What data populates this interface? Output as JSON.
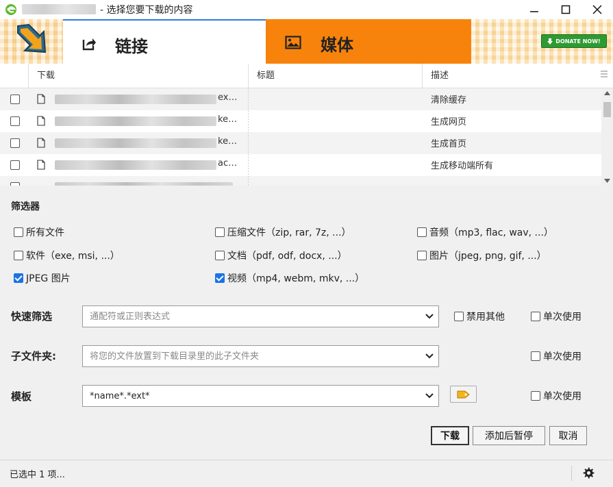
{
  "window": {
    "title": "- 选择您要下载的内容",
    "controls": [
      "minimize-icon",
      "maximize-icon",
      "close-icon"
    ]
  },
  "tabs": [
    {
      "label": "链接",
      "icon": "share-arrow-icon",
      "active": true
    },
    {
      "label": "媒体",
      "icon": "image-icon",
      "active": false
    }
  ],
  "donate_label": "DONATE NOW!",
  "colors": {
    "media_tab": "#f7830c",
    "active_tab_border": "#2b7de0",
    "donate": "#2f9a32",
    "checkbox_checked": "#1a73e8"
  },
  "table": {
    "columns": [
      "下载",
      "标题",
      "描述"
    ],
    "rows": [
      {
        "suffix": "ex…",
        "title": "",
        "desc": "清除缓存",
        "checked": false
      },
      {
        "suffix": "ke…",
        "title": "",
        "desc": "生成网页",
        "checked": false
      },
      {
        "suffix": "ke…",
        "title": "",
        "desc": "生成首页",
        "checked": false
      },
      {
        "suffix": "ac…",
        "title": "",
        "desc": "生成移动端所有",
        "checked": false
      }
    ]
  },
  "filters": {
    "title": "筛选器",
    "items": [
      {
        "label": "所有文件",
        "checked": false
      },
      {
        "label": "压缩文件（zip, rar, 7z, ...）",
        "checked": false
      },
      {
        "label": "音频（mp3, flac, wav, ...）",
        "checked": false
      },
      {
        "label": "软件（exe, msi, ...）",
        "checked": false
      },
      {
        "label": "文档（pdf, odf, docx, ...）",
        "checked": false
      },
      {
        "label": "图片（jpeg, png, gif, ...）",
        "checked": false
      },
      {
        "label": "JPEG 图片",
        "checked": true
      },
      {
        "label": "视频（mp4, webm, mkv, ...）",
        "checked": true
      }
    ]
  },
  "quick_filter": {
    "label": "快速筛选",
    "placeholder": "通配符或正则表达式",
    "disable_others": "禁用其他",
    "once": "单次使用"
  },
  "subfolder": {
    "label": "子文件夹:",
    "placeholder": "将您的文件放置到下载目录里的此子文件夹",
    "once": "单次使用"
  },
  "template": {
    "label": "模板",
    "value": "*name*.*ext*",
    "once": "单次使用"
  },
  "buttons": {
    "download": "下载",
    "add_paused": "添加后暂停",
    "cancel": "取消"
  },
  "status": {
    "text": "已选中 1 项..."
  }
}
